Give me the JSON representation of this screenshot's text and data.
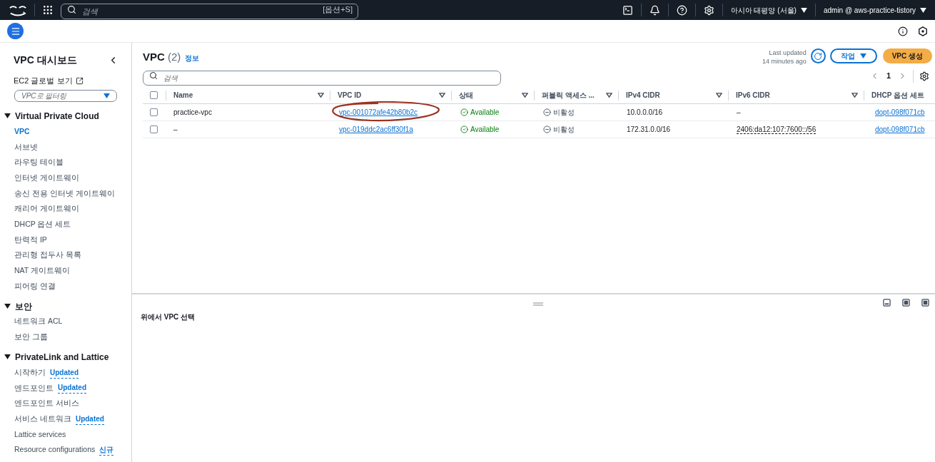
{
  "top_bar": {
    "search_placeholder": "검색",
    "search_shortcut": "[옵션+S]",
    "region": "아시아 태평양 (서울)",
    "account": "admin @ aws-practice-tistory"
  },
  "sidebar": {
    "title": "VPC 대시보드",
    "ec2_link": "EC2 글로벌 보기",
    "filter_placeholder": "VPC로 필터링",
    "sections": [
      {
        "title": "Virtual Private Cloud",
        "expanded": true,
        "items": [
          {
            "label": "VPC",
            "selected": true
          },
          {
            "label": "서브넷",
            "selected": false
          },
          {
            "label": "라우팅 테이블",
            "selected": false
          },
          {
            "label": "인터넷 게이트웨이",
            "selected": false
          },
          {
            "label": "송신 전용 인터넷 게이트웨이",
            "selected": false
          },
          {
            "label": "캐리어 게이트웨이",
            "selected": false
          },
          {
            "label": "DHCP 옵션 세트",
            "selected": false
          },
          {
            "label": "탄력적 IP",
            "selected": false
          },
          {
            "label": "관리형 접두사 목록",
            "selected": false
          },
          {
            "label": "NAT 게이트웨이",
            "selected": false
          },
          {
            "label": "피어링 연결",
            "selected": false
          }
        ]
      },
      {
        "title": "보안",
        "expanded": true,
        "items": [
          {
            "label": "네트워크 ACL",
            "selected": false
          },
          {
            "label": "보안 그룹",
            "selected": false
          }
        ]
      },
      {
        "title": "PrivateLink and Lattice",
        "expanded": true,
        "items": [
          {
            "label": "시작하기",
            "selected": false,
            "badge": "Updated"
          },
          {
            "label": "엔드포인트",
            "selected": false,
            "badge": "Updated"
          },
          {
            "label": "엔드포인트 서비스",
            "selected": false
          },
          {
            "label": "서비스 네트워크",
            "selected": false,
            "badge": "Updated"
          },
          {
            "label": "Lattice services",
            "selected": false
          },
          {
            "label": "Resource configurations",
            "selected": false,
            "badge": "신규"
          }
        ]
      }
    ]
  },
  "main": {
    "title": "VPC",
    "count": "(2)",
    "info_link": "정보",
    "last_updated": "Last updated",
    "last_updated_time": "14 minutes ago",
    "actions_button": "작업",
    "create_button": "VPC 생성",
    "search_placeholder": "검색",
    "page": "1",
    "table": {
      "select_all_checked": false,
      "columns": [
        "Name",
        "VPC ID",
        "상태",
        "퍼블릭 액세스 ...",
        "IPv4 CIDR",
        "IPv6 CIDR",
        "DHCP 옵션 세트"
      ],
      "rows": [
        {
          "checked": false,
          "name": "practice-vpc",
          "vpc_id": "vpc-001072afe42b80b2c",
          "circled": true,
          "state": "Available",
          "public_access": "비활성",
          "ipv4": "10.0.0.0/16",
          "ipv6": "–",
          "ipv6_link": false,
          "dhcp": "dopt-098f071cb"
        },
        {
          "checked": false,
          "name": "–",
          "vpc_id": "vpc-019ddc2ac6ff30f1a",
          "circled": false,
          "state": "Available",
          "public_access": "비활성",
          "ipv4": "172.31.0.0/16",
          "ipv6": "2406:da12:107:7600::/56",
          "ipv6_link": true,
          "dhcp": "dopt-098f071cb"
        }
      ]
    }
  },
  "detail_pane": {
    "message": "위에서 VPC 선택"
  }
}
